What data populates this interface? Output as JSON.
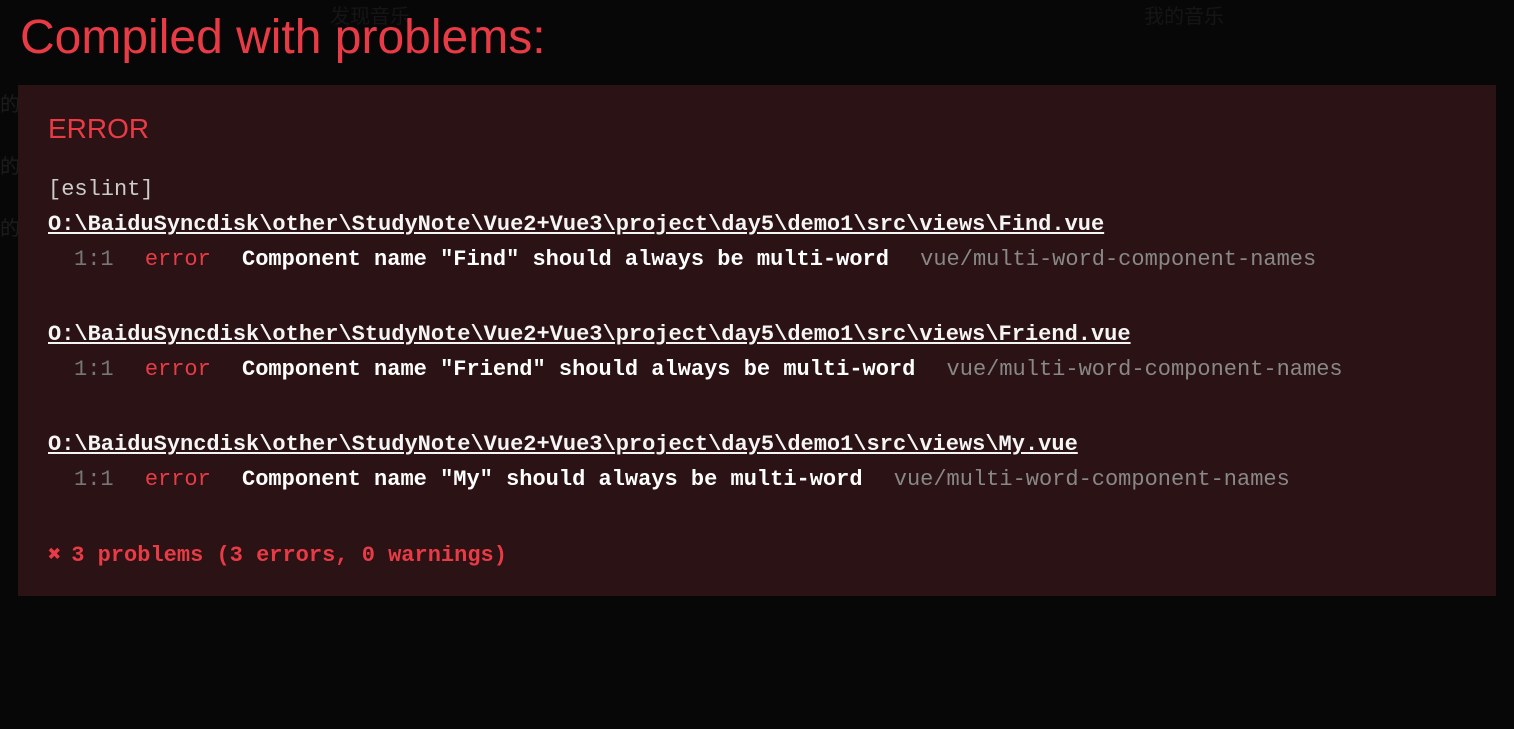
{
  "background": {
    "nav_left": "发现音乐",
    "nav_right": "我的音乐",
    "text": "的朋友"
  },
  "title": "Compiled with problems:",
  "error_label": "ERROR",
  "eslint_tag": "[eslint]",
  "errors": [
    {
      "file": "O:\\BaiduSyncdisk\\other\\StudyNote\\Vue2+Vue3\\project\\day5\\demo1\\src\\views\\Find.vue",
      "line": "1:1",
      "level": "error",
      "message": "Component name \"Find\" should always be multi-word",
      "rule": "vue/multi-word-component-names"
    },
    {
      "file": "O:\\BaiduSyncdisk\\other\\StudyNote\\Vue2+Vue3\\project\\day5\\demo1\\src\\views\\Friend.vue",
      "line": "1:1",
      "level": "error",
      "message": "Component name \"Friend\" should always be multi-word",
      "rule": "vue/multi-word-component-names"
    },
    {
      "file": "O:\\BaiduSyncdisk\\other\\StudyNote\\Vue2+Vue3\\project\\day5\\demo1\\src\\views\\My.vue",
      "line": "1:1",
      "level": "error",
      "message": "Component name \"My\" should always be multi-word",
      "rule": "vue/multi-word-component-names"
    }
  ],
  "summary": {
    "icon": "✖",
    "text": "3 problems (3 errors, 0 warnings)"
  }
}
